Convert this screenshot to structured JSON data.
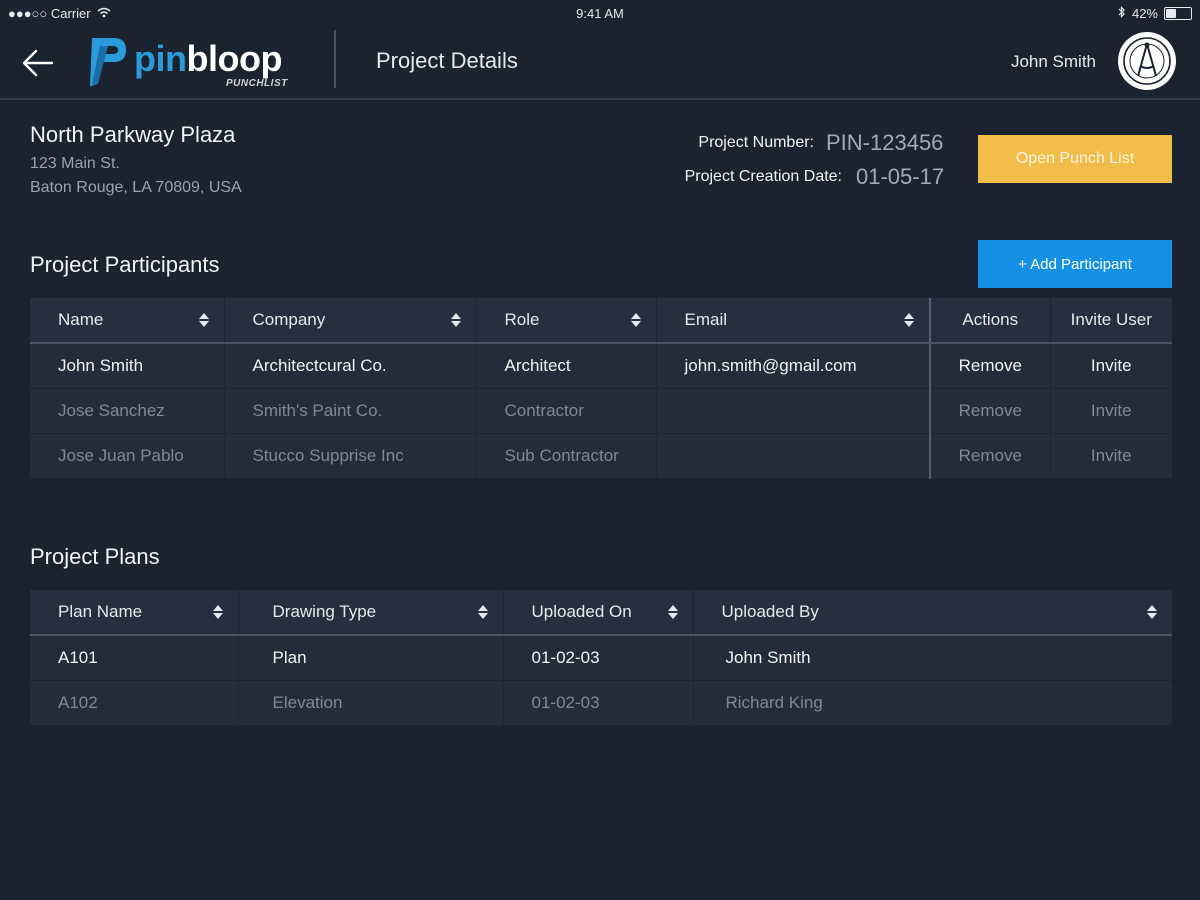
{
  "status_bar": {
    "carrier": "●●●○○ Carrier",
    "time": "9:41 AM",
    "battery": "42%",
    "battery_level": 0.42
  },
  "header": {
    "brand_part1": "pin",
    "brand_part2": "bloop",
    "brand_sub": "PUNCHLIST",
    "page_title": "Project Details",
    "user_name": "John Smith"
  },
  "project": {
    "name": "North Parkway Plaza",
    "address_line1": "123 Main St.",
    "address_line2": "Baton Rouge, LA 70809, USA",
    "number_label": "Project Number:",
    "number_value": "PIN-123456",
    "date_label": "Project Creation Date:",
    "date_value": "01-05-17",
    "open_punch_list_label": "Open Punch List"
  },
  "participants": {
    "title": "Project Participants",
    "add_label": "+ Add Participant",
    "columns": [
      "Name",
      "Company",
      "Role",
      "Email",
      "Actions",
      "Invite User"
    ],
    "rows": [
      {
        "name": "John Smith",
        "company": "Architectcural Co.",
        "role": "Architect",
        "email": "john.smith@gmail.com",
        "action": "Remove",
        "invite": "Invite"
      },
      {
        "name": "Jose Sanchez",
        "company": "Smith's Paint Co.",
        "role": "Contractor",
        "email": "",
        "action": "Remove",
        "invite": "Invite"
      },
      {
        "name": "Jose Juan Pablo",
        "company": "Stucco Supprise Inc",
        "role": "Sub Contractor",
        "email": "",
        "action": "Remove",
        "invite": "Invite"
      }
    ]
  },
  "plans": {
    "title": "Project Plans",
    "columns": [
      "Plan Name",
      "Drawing Type",
      "Uploaded On",
      "Uploaded By"
    ],
    "rows": [
      {
        "name": "A101",
        "type": "Plan",
        "date": "01-02-03",
        "by": "John Smith"
      },
      {
        "name": "A102",
        "type": "Elevation",
        "date": "01-02-03",
        "by": "Richard King"
      }
    ]
  },
  "colors": {
    "background": "#1b2230",
    "accent_blue": "#1591e4",
    "accent_yellow": "#f1bc49",
    "brand_blue": "#2a9bd9"
  },
  "icons": {
    "back": "arrow-left-icon",
    "logo": "pinbloop-logo-icon",
    "avatar": "compass-avatar-icon",
    "sort": "sort-arrows-icon",
    "wifi": "wifi-icon",
    "bluetooth": "bluetooth-icon",
    "battery": "battery-icon"
  }
}
